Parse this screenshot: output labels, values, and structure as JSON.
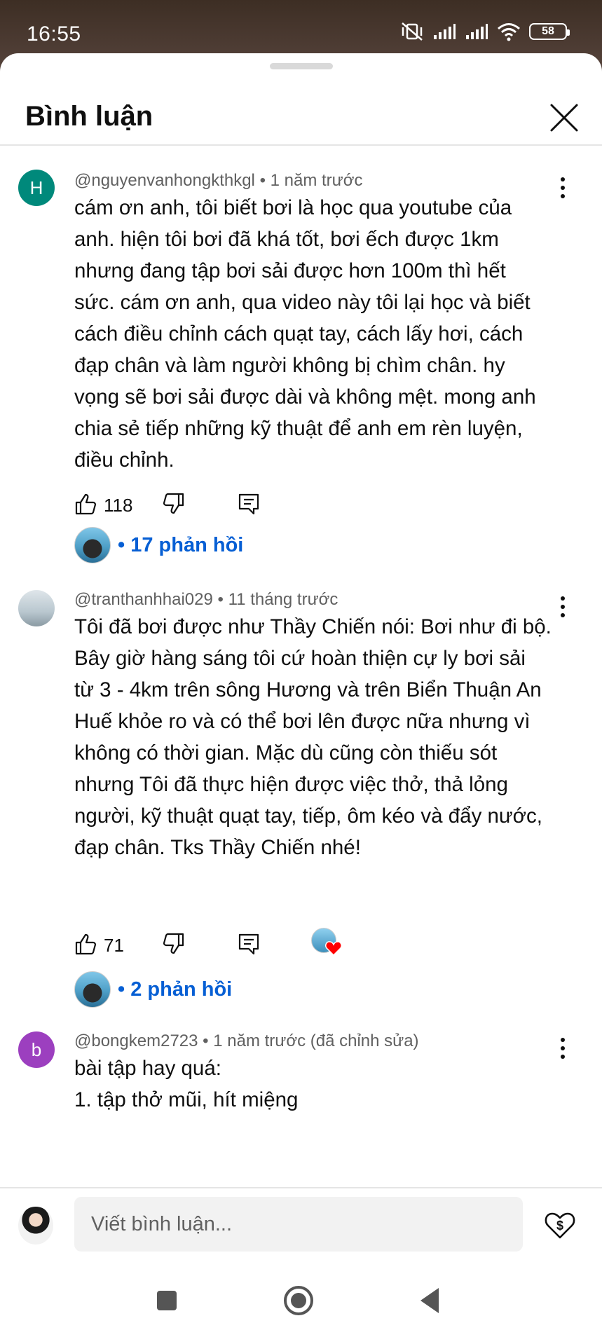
{
  "status_bar": {
    "time": "16:55",
    "battery": "58",
    "icons": [
      "mute-vibrate-icon",
      "signal-icon",
      "signal-icon",
      "wifi-icon",
      "battery-icon"
    ]
  },
  "sheet": {
    "title": "Bình luận"
  },
  "comments": [
    {
      "avatar_letter": "H",
      "avatar_color": "#00897b",
      "author": "@nguyenvanhongkthkgl",
      "time": "1 năm trước",
      "text": "cám ơn anh, tôi biết bơi là học qua youtube của\nanh. hiện tôi bơi đã khá tốt, bơi ếch được 1km\nnhưng đang tập bơi sải được hơn 100m thì hết\nsức. cám ơn anh, qua video này tôi lại học và biết\ncách điều chỉnh cách quạt tay, cách lấy hơi, cách\nđạp chân và làm người không bị chìm chân. hy\nvọng sẽ bơi sải được dài và không mệt. mong anh\nchia sẻ tiếp những kỹ thuật để anh em rèn luyện,\nđiều chỉnh.",
      "likes": "118",
      "replies": "• 17 phản hồi"
    },
    {
      "avatar_letter": "",
      "avatar_color": "#cfd8dc",
      "author": "@tranthanhhai029",
      "time": "11 tháng trước",
      "text": "Tôi đã bơi được như Thầy Chiến nói: Bơi như đi bộ.\nBây giờ hàng sáng tôi cứ hoàn thiện cự ly bơi sải\ntừ 3 - 4km trên sông Hương và trên Biển Thuận An\nHuế khỏe ro và có thể bơi lên được nữa nhưng vì\nkhông có thời gian. Mặc dù cũng còn thiếu sót\nnhưng Tôi đã thực hiện được việc thở, thả lỏng\nngười, kỹ thuật quạt tay, tiếp, ôm kéo và đẩy nước,\nđạp chân. Tks Thầy Chiến nhé!",
      "likes": "71",
      "replies": "• 2 phản hồi"
    },
    {
      "avatar_letter": "b",
      "avatar_color": "#9c3fbf",
      "author": "@bongkem2723",
      "time": "1 năm trước (đã chỉnh sửa)",
      "text": "bài tập hay quá:\n1. tập thở mũi, hít miệng"
    }
  ],
  "composer": {
    "placeholder": "Viết bình luận..."
  },
  "colors": {
    "link": "#065fd4",
    "heart": "#ff0000"
  }
}
